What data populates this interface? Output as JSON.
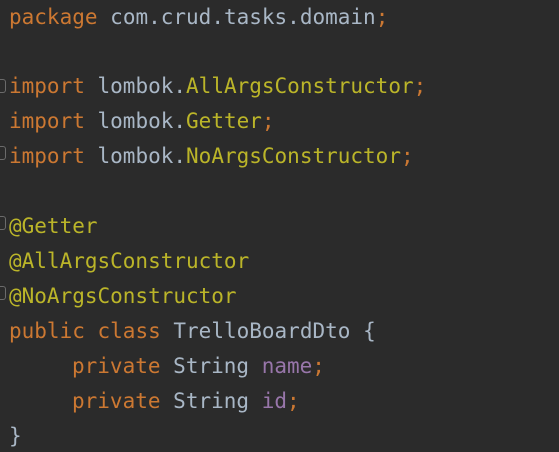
{
  "code": {
    "package_line": {
      "keyword": "package",
      "name": "com.crud.tasks.domain",
      "semicolon": ";"
    },
    "imports": [
      {
        "keyword": "import",
        "prefix": "lombok.",
        "name": "AllArgsConstructor",
        "semicolon": ";"
      },
      {
        "keyword": "import",
        "prefix": "lombok.",
        "name": "Getter",
        "semicolon": ";"
      },
      {
        "keyword": "import",
        "prefix": "lombok.",
        "name": "NoArgsConstructor",
        "semicolon": ";"
      }
    ],
    "annotations": [
      "@Getter",
      "@AllArgsConstructor",
      "@NoArgsConstructor"
    ],
    "class_decl": {
      "modifier": "public",
      "keyword": "class",
      "name": "TrelloBoardDto",
      "open_brace": "{"
    },
    "fields": [
      {
        "modifier": "private",
        "type": "String",
        "name": "name",
        "semicolon": ";"
      },
      {
        "modifier": "private",
        "type": "String",
        "name": "id",
        "semicolon": ";"
      }
    ],
    "close_brace": "}"
  },
  "colors": {
    "background": "#2b2b2b",
    "keyword": "#cc7832",
    "annotation": "#bbb529",
    "field": "#9876aa",
    "text": "#a9b7c6"
  }
}
